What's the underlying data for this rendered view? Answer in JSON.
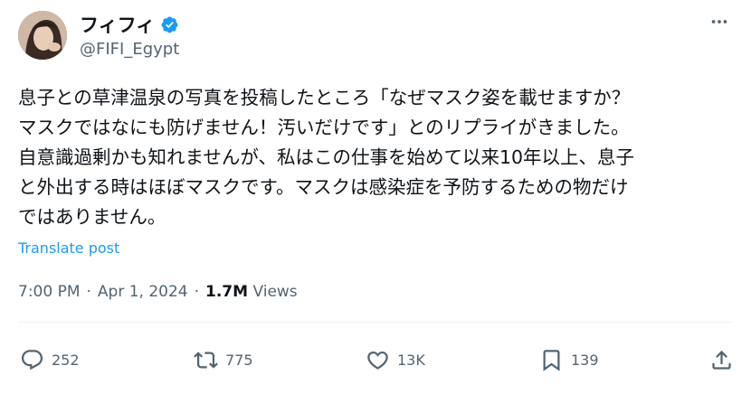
{
  "author": {
    "display_name": "フィフィ",
    "handle": "@FIFI_Egypt"
  },
  "tweet": {
    "text": "息子との草津温泉の写真を投稿したところ「なぜマスク姿を載せますか？\nマスクではなにも防げません！汚いだけです」とのリプライがきました。\n自意識過剰かも知れませんが、私はこの仕事を始めて以来10年以上、息子\nと外出する時はほぼマスクです。マスクは感染症を予防するための物だけ\nではありません。",
    "translate_label": "Translate post"
  },
  "meta": {
    "time": "7:00 PM",
    "date": "Apr 1, 2024",
    "views_count": "1.7M",
    "views_label": "Views",
    "separator": "·"
  },
  "actions": {
    "replies": "252",
    "reposts": "775",
    "likes": "13K",
    "bookmarks": "139"
  },
  "colors": {
    "accent": "#1d9bf0",
    "secondary_text": "#536471",
    "primary_text": "#0f1419"
  },
  "icons": [
    "verified-badge-icon",
    "more-icon",
    "reply-icon",
    "repost-icon",
    "like-icon",
    "bookmark-icon",
    "share-icon"
  ]
}
